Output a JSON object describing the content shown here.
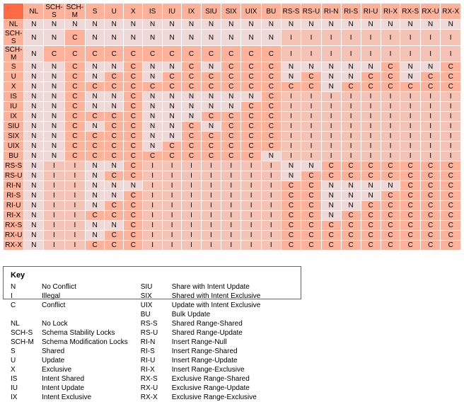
{
  "columns": [
    "NL",
    "SCH-S",
    "SCH-M",
    "S",
    "U",
    "X",
    "IS",
    "IU",
    "IX",
    "SIU",
    "SIX",
    "UIX",
    "BU",
    "RS-S",
    "RS-U",
    "RI-N",
    "RI-S",
    "RI-U",
    "RI-X",
    "RX-S",
    "RX-U",
    "RX-X"
  ],
  "matrix": {
    "NL": [
      "N",
      "N",
      "N",
      "N",
      "N",
      "N",
      "N",
      "N",
      "N",
      "N",
      "N",
      "N",
      "N",
      "N",
      "N",
      "N",
      "N",
      "N",
      "N",
      "N",
      "N",
      "N"
    ],
    "SCH-S": [
      "N",
      "N",
      "C",
      "N",
      "N",
      "N",
      "N",
      "N",
      "N",
      "N",
      "N",
      "N",
      "N",
      "I",
      "I",
      "I",
      "I",
      "I",
      "I",
      "I",
      "I",
      "I"
    ],
    "SCH-M": [
      "N",
      "C",
      "C",
      "C",
      "C",
      "C",
      "C",
      "C",
      "C",
      "C",
      "C",
      "C",
      "C",
      "I",
      "I",
      "I",
      "I",
      "I",
      "I",
      "I",
      "I",
      "I"
    ],
    "S": [
      "N",
      "N",
      "C",
      "N",
      "N",
      "C",
      "N",
      "N",
      "C",
      "N",
      "C",
      "C",
      "C",
      "N",
      "N",
      "N",
      "N",
      "N",
      "C",
      "N",
      "N",
      "C"
    ],
    "U": [
      "N",
      "N",
      "C",
      "N",
      "C",
      "C",
      "N",
      "C",
      "C",
      "C",
      "C",
      "C",
      "C",
      "N",
      "C",
      "N",
      "N",
      "C",
      "C",
      "N",
      "C",
      "C"
    ],
    "X": [
      "N",
      "N",
      "C",
      "C",
      "C",
      "C",
      "C",
      "C",
      "C",
      "C",
      "C",
      "C",
      "C",
      "C",
      "C",
      "N",
      "C",
      "C",
      "C",
      "C",
      "C",
      "C"
    ],
    "IS": [
      "N",
      "N",
      "C",
      "N",
      "N",
      "C",
      "N",
      "N",
      "N",
      "N",
      "N",
      "N",
      "C",
      "I",
      "I",
      "I",
      "I",
      "I",
      "I",
      "I",
      "I",
      "I"
    ],
    "IU": [
      "N",
      "N",
      "C",
      "N",
      "N",
      "C",
      "N",
      "N",
      "N",
      "N",
      "N",
      "C",
      "C",
      "I",
      "I",
      "I",
      "I",
      "I",
      "I",
      "I",
      "I",
      "I"
    ],
    "IX": [
      "N",
      "N",
      "C",
      "C",
      "C",
      "C",
      "N",
      "N",
      "N",
      "C",
      "C",
      "C",
      "C",
      "I",
      "I",
      "I",
      "I",
      "I",
      "I",
      "I",
      "I",
      "I"
    ],
    "SIU": [
      "N",
      "N",
      "C",
      "N",
      "C",
      "C",
      "N",
      "N",
      "C",
      "N",
      "C",
      "C",
      "C",
      "I",
      "I",
      "I",
      "I",
      "I",
      "I",
      "I",
      "I",
      "I"
    ],
    "SIX": [
      "N",
      "N",
      "C",
      "C",
      "C",
      "C",
      "N",
      "N",
      "C",
      "C",
      "C",
      "C",
      "C",
      "I",
      "I",
      "I",
      "I",
      "I",
      "I",
      "I",
      "I",
      "I"
    ],
    "UIX": [
      "N",
      "N",
      "C",
      "C",
      "C",
      "C",
      "N",
      "C",
      "C",
      "C",
      "C",
      "C",
      "C",
      "I",
      "I",
      "I",
      "I",
      "I",
      "I",
      "I",
      "I",
      "I"
    ],
    "BU": [
      "N",
      "N",
      "C",
      "C",
      "C",
      "C",
      "C",
      "C",
      "C",
      "C",
      "C",
      "C",
      "N",
      "I",
      "I",
      "I",
      "I",
      "I",
      "I",
      "I",
      "I",
      "I"
    ],
    "RS-S": [
      "N",
      "I",
      "I",
      "N",
      "N",
      "C",
      "I",
      "I",
      "I",
      "I",
      "I",
      "I",
      "I",
      "N",
      "N",
      "C",
      "C",
      "C",
      "C",
      "C",
      "C",
      "C"
    ],
    "RS-U": [
      "N",
      "I",
      "I",
      "N",
      "C",
      "C",
      "I",
      "I",
      "I",
      "I",
      "I",
      "I",
      "I",
      "N",
      "C",
      "C",
      "C",
      "C",
      "C",
      "C",
      "C",
      "C"
    ],
    "RI-N": [
      "N",
      "I",
      "I",
      "N",
      "N",
      "N",
      "I",
      "I",
      "I",
      "I",
      "I",
      "I",
      "I",
      "C",
      "C",
      "N",
      "N",
      "N",
      "N",
      "C",
      "C",
      "C"
    ],
    "RI-S": [
      "N",
      "I",
      "I",
      "N",
      "N",
      "C",
      "I",
      "I",
      "I",
      "I",
      "I",
      "I",
      "I",
      "C",
      "C",
      "N",
      "N",
      "N",
      "C",
      "C",
      "C",
      "C"
    ],
    "RI-U": [
      "N",
      "I",
      "I",
      "N",
      "C",
      "C",
      "I",
      "I",
      "I",
      "I",
      "I",
      "I",
      "I",
      "C",
      "C",
      "N",
      "N",
      "C",
      "C",
      "C",
      "C",
      "C"
    ],
    "RI-X": [
      "N",
      "I",
      "I",
      "C",
      "C",
      "C",
      "I",
      "I",
      "I",
      "I",
      "I",
      "I",
      "I",
      "C",
      "C",
      "N",
      "C",
      "C",
      "C",
      "C",
      "C",
      "C"
    ],
    "RX-S": [
      "N",
      "I",
      "I",
      "N",
      "N",
      "C",
      "I",
      "I",
      "I",
      "I",
      "I",
      "I",
      "I",
      "C",
      "C",
      "C",
      "C",
      "C",
      "C",
      "C",
      "C",
      "C"
    ],
    "RX-U": [
      "N",
      "I",
      "I",
      "N",
      "C",
      "C",
      "I",
      "I",
      "I",
      "I",
      "I",
      "I",
      "I",
      "C",
      "C",
      "C",
      "C",
      "C",
      "C",
      "C",
      "C",
      "C"
    ],
    "RX-X": [
      "N",
      "I",
      "I",
      "C",
      "C",
      "C",
      "I",
      "I",
      "I",
      "I",
      "I",
      "I",
      "I",
      "C",
      "C",
      "C",
      "C",
      "C",
      "C",
      "C",
      "C",
      "C"
    ]
  },
  "key": {
    "title": "Key",
    "left": [
      [
        "N",
        "No Conflict"
      ],
      [
        "I",
        "Illegal"
      ],
      [
        "C",
        "Conflict"
      ],
      [
        "",
        ""
      ],
      [
        "NL",
        "No Lock"
      ],
      [
        "SCH-S",
        "Schema Stability Locks"
      ],
      [
        "SCH-M",
        "Schema Modification Locks"
      ],
      [
        "S",
        "Shared"
      ],
      [
        "U",
        "Update"
      ],
      [
        "X",
        "Exclusive"
      ],
      [
        "IS",
        "Intent Shared"
      ],
      [
        "IU",
        "Intent Update"
      ],
      [
        "IX",
        "Intent Exclusive"
      ]
    ],
    "right": [
      [
        "SIU",
        "Share with Intent Update"
      ],
      [
        "SIX",
        "Shared with Intent Exclusive"
      ],
      [
        "UIX",
        "Update with Intent Exclusive"
      ],
      [
        "BU",
        "Bulk Update"
      ],
      [
        "RS-S",
        "Shared Range-Shared"
      ],
      [
        "RS-U",
        "Shared Range-Update"
      ],
      [
        "RI-N",
        "Insert Range-Null"
      ],
      [
        "RI-S",
        "Insert Range-Shared"
      ],
      [
        "RI-U",
        "Insert Range-Update"
      ],
      [
        "RI-X",
        "Insert Range-Exclusive"
      ],
      [
        "RX-S",
        "Exclusive Range-Shared"
      ],
      [
        "RX-U",
        "Exclusive Range-Update"
      ],
      [
        "RX-X",
        "Exclusive Range-Exclusive"
      ]
    ]
  }
}
